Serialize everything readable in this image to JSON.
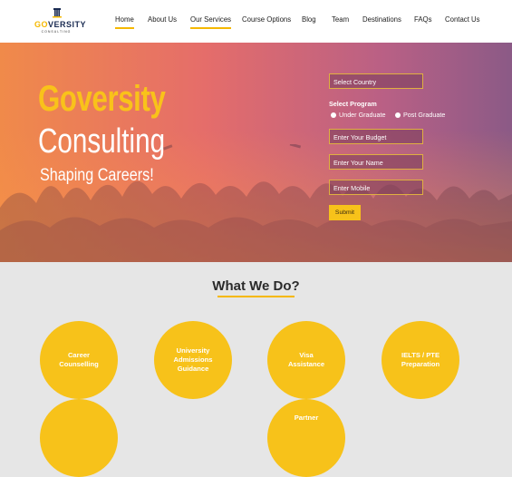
{
  "logo": {
    "prefix": "GO",
    "rest": "VERSITY",
    "tagline": "CONSULTING"
  },
  "nav": [
    {
      "label": "Home",
      "active": true
    },
    {
      "label": "About Us",
      "active": false
    },
    {
      "label": "Our Services",
      "active": true
    },
    {
      "label": "Course Options",
      "active": false
    },
    {
      "label": "Blog",
      "active": false
    },
    {
      "label": "Team",
      "active": false
    },
    {
      "label": "Destinations",
      "active": false
    },
    {
      "label": "FAQs",
      "active": false
    },
    {
      "label": "Contact Us",
      "active": false
    }
  ],
  "hero": {
    "title_line1": "Goversity",
    "title_line2": "Consulting",
    "tagline": "Shaping Careers!"
  },
  "form": {
    "country_select": "Select Country",
    "program_label": "Select Program",
    "radio_under": "Under Graduate",
    "radio_post": "Post Graduate",
    "budget_placeholder": "Enter Your Budget",
    "name_placeholder": "Enter Your Name",
    "mobile_placeholder": "Enter Mobile",
    "submit_label": "Submit"
  },
  "services": {
    "title": "What We Do?",
    "items": [
      "Career\nCounselling",
      "University\nAdmissions\nGuidance",
      "Visa\nAssistance",
      "IELTS / PTE\nPreparation",
      "",
      "Partner"
    ]
  },
  "colors": {
    "accent": "#f7c21a",
    "text_dark": "#1d1d1d",
    "hero_overlay": "#e56d6a"
  }
}
